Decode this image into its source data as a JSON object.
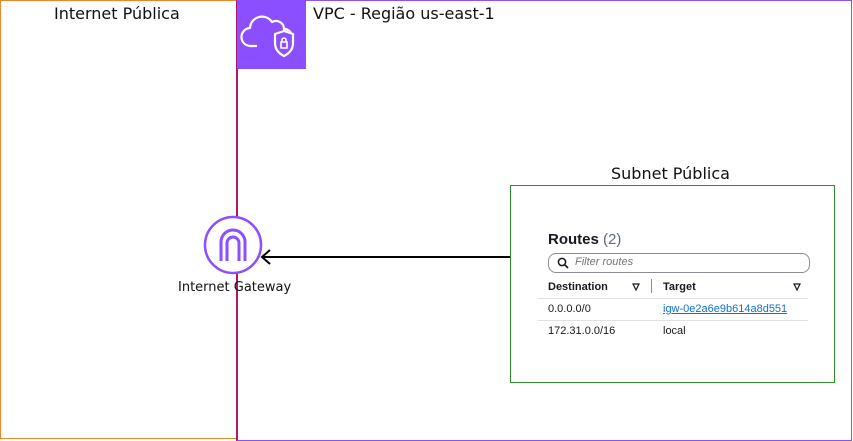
{
  "internet": {
    "title": "Internet Pública"
  },
  "vpc": {
    "title": "VPC - Região us-east-1",
    "icon": "vpc-shield-cloud-icon"
  },
  "gateway": {
    "label": "Internet Gateway",
    "icon": "internet-gateway-icon"
  },
  "subnet": {
    "title": "Subnet Pública"
  },
  "routes": {
    "heading": "Routes",
    "count": "(2)",
    "filter_placeholder": "Filter routes",
    "columns": [
      "Destination",
      "Target"
    ],
    "rows": [
      {
        "destination": "0.0.0.0/0",
        "target": "igw-0e2a6e9b614a8d551"
      },
      {
        "destination": "172.31.0.0/16",
        "target": "local"
      }
    ]
  },
  "colors": {
    "internet_border": "#e8882a",
    "vpc_border": "#8c4fff",
    "subnet_border": "#2e8b2e",
    "link": "#0972d3"
  }
}
